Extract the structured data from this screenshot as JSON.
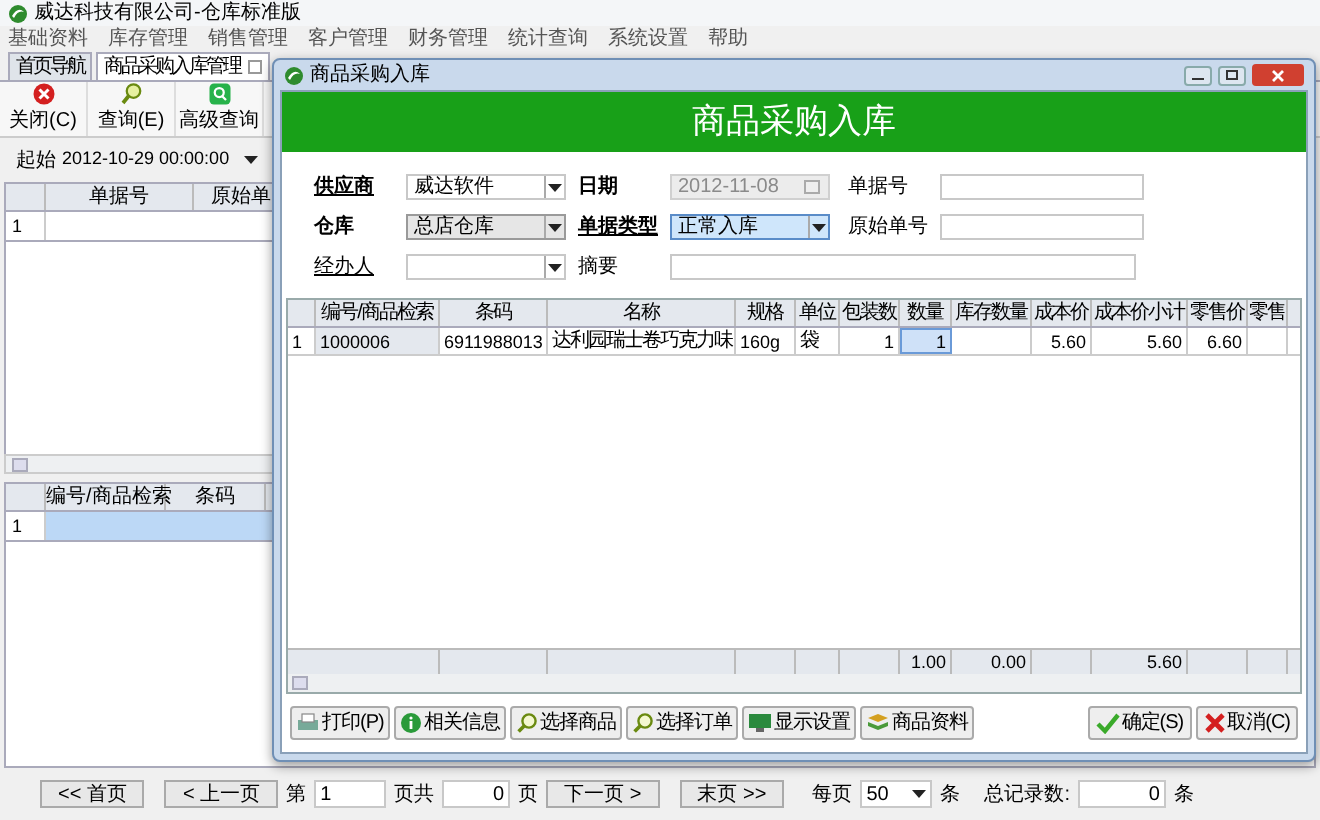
{
  "window": {
    "title": "威达科技有限公司-仓库标准版"
  },
  "menu": [
    "基础资料",
    "库存管理",
    "销售管理",
    "客户管理",
    "财务管理",
    "统计查询",
    "系统设置",
    "帮助"
  ],
  "tabs": [
    {
      "label": "首页导航",
      "selected": false,
      "closable": false
    },
    {
      "label": "商品采购入库管理",
      "selected": true,
      "closable": true
    }
  ],
  "toolbar": [
    "关闭(C)",
    "查询(E)",
    "高级查询"
  ],
  "filter": {
    "label": "起始",
    "value": "2012-10-29 00:00:00"
  },
  "orders_table": {
    "columns": [
      "单据号",
      "原始单"
    ],
    "rows": [
      {
        "number": "1",
        "selected": false
      }
    ]
  },
  "items_table": {
    "columns": [
      "编号/商品检索",
      "条码"
    ],
    "rows": [
      {
        "number": "1",
        "selected": true
      }
    ]
  },
  "pager": {
    "first": "<< 首页",
    "prev": "< 上一页",
    "page_label": "第",
    "page": "1",
    "total_label": "页共",
    "total_pages": "0",
    "pages_unit": "页",
    "next": "下一页 >",
    "last": "末页 >>",
    "per_page_label": "每页",
    "per_page": "50",
    "per_page_unit": "条",
    "count_label": "总记录数:",
    "count": "0",
    "count_unit": "条"
  },
  "dialog": {
    "title": "商品采购入库",
    "heading": "商品采购入库",
    "fields": [
      {
        "label": "供应商",
        "required": true,
        "link": true,
        "kind": "combo",
        "value": "威达软件",
        "disabled": false,
        "focused": false
      },
      {
        "label": "日期",
        "required": true,
        "link": false,
        "kind": "date",
        "value": "2012-11-08",
        "disabled": true,
        "focused": false
      },
      {
        "label": "单据号",
        "required": false,
        "link": false,
        "kind": "text",
        "disabled": false,
        "focused": false
      },
      {
        "label": "仓库",
        "required": true,
        "link": false,
        "kind": "dropdown",
        "value": "总店仓库",
        "disabled": false,
        "focused": false
      },
      {
        "label": "单据类型",
        "required": true,
        "link": true,
        "kind": "combo",
        "value": "正常入库",
        "disabled": false,
        "focused": true
      },
      {
        "label": "原始单号",
        "required": false,
        "link": false,
        "kind": "text",
        "disabled": false,
        "focused": false
      },
      {
        "label": "经办人",
        "required": false,
        "link": true,
        "kind": "combo",
        "disabled": false,
        "focused": false
      },
      {
        "label": "摘要",
        "required": false,
        "link": false,
        "kind": "wide",
        "disabled": false,
        "focused": false
      }
    ],
    "table": {
      "columns": [
        "编号/商品检索",
        "条码",
        "名称",
        "规格",
        "单位",
        "包装数",
        "数量",
        "库存数量",
        "成本价",
        "成本价小计",
        "零售价",
        "零售"
      ],
      "rows": [
        {
          "number": "1",
          "cells": [
            {
              "text": "1000006",
              "selected": false
            },
            {
              "text": "6911988013",
              "selected": false
            },
            {
              "text": "达利园瑞士卷巧克力味",
              "selected": false
            },
            {
              "text": "160g",
              "selected": false
            },
            {
              "text": "袋",
              "selected": false
            },
            {
              "text": "1",
              "selected": false
            },
            {
              "text": "1",
              "selected": true
            },
            {
              "selected": false
            },
            {
              "text": "5.60",
              "selected": false
            },
            {
              "text": "5.60",
              "selected": false
            },
            {
              "text": "6.60",
              "selected": false
            },
            {
              "selected": false
            }
          ]
        }
      ],
      "totals": {
        "quantity": "1.00",
        "stock_quantity": "0.00",
        "cost_subtotal": "5.60"
      }
    },
    "buttons": [
      "打印(P)",
      "相关信息",
      "选择商品",
      "选择订单",
      "显示设置",
      "商品资料"
    ],
    "actions": [
      "确定(S)",
      "取消(C)"
    ]
  }
}
